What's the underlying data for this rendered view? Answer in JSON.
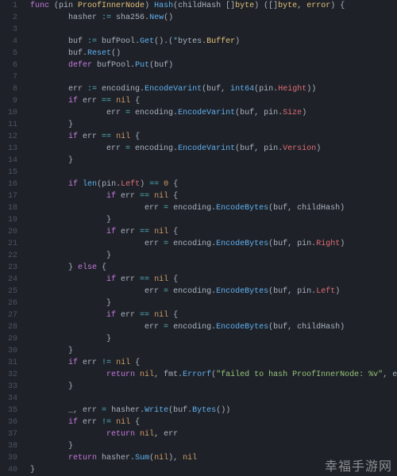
{
  "watermark": "幸福手游网",
  "gutter": {
    "start": 1,
    "end": 40
  },
  "code": {
    "l1": {
      "indent": 0,
      "seg": [
        [
          "kw",
          "func"
        ],
        [
          "pun",
          " ("
        ],
        [
          "var",
          "pin "
        ],
        [
          "typ",
          "ProofInnerNode"
        ],
        [
          "pun",
          ") "
        ],
        [
          "fn",
          "Hash"
        ],
        [
          "pun",
          "("
        ],
        [
          "var",
          "childHash "
        ],
        [
          "pun",
          "[]"
        ],
        [
          "typ",
          "byte"
        ],
        [
          "pun",
          ") ([]"
        ],
        [
          "typ",
          "byte"
        ],
        [
          "pun",
          ", "
        ],
        [
          "typ",
          "error"
        ],
        [
          "pun",
          ") {"
        ]
      ]
    },
    "l2": {
      "indent": 2,
      "seg": [
        [
          "var",
          "hasher "
        ],
        [
          "op",
          ":="
        ],
        [
          "var",
          " sha256"
        ],
        [
          "pun",
          "."
        ],
        [
          "fn",
          "New"
        ],
        [
          "pun",
          "()"
        ]
      ]
    },
    "l3": {
      "indent": 0,
      "seg": []
    },
    "l4": {
      "indent": 2,
      "seg": [
        [
          "var",
          "buf "
        ],
        [
          "op",
          ":="
        ],
        [
          "var",
          " bufPool"
        ],
        [
          "pun",
          "."
        ],
        [
          "fn",
          "Get"
        ],
        [
          "pun",
          "().("
        ],
        [
          "op",
          "*"
        ],
        [
          "var",
          "bytes"
        ],
        [
          "pun",
          "."
        ],
        [
          "typ",
          "Buffer"
        ],
        [
          "pun",
          ")"
        ]
      ]
    },
    "l5": {
      "indent": 2,
      "seg": [
        [
          "var",
          "buf"
        ],
        [
          "pun",
          "."
        ],
        [
          "fn",
          "Reset"
        ],
        [
          "pun",
          "()"
        ]
      ]
    },
    "l6": {
      "indent": 2,
      "seg": [
        [
          "kw",
          "defer"
        ],
        [
          "var",
          " bufPool"
        ],
        [
          "pun",
          "."
        ],
        [
          "fn",
          "Put"
        ],
        [
          "pun",
          "("
        ],
        [
          "var",
          "buf"
        ],
        [
          "pun",
          ")"
        ]
      ]
    },
    "l7": {
      "indent": 0,
      "seg": []
    },
    "l8": {
      "indent": 2,
      "seg": [
        [
          "var",
          "err "
        ],
        [
          "op",
          ":="
        ],
        [
          "var",
          " encoding"
        ],
        [
          "pun",
          "."
        ],
        [
          "fn",
          "EncodeVarint"
        ],
        [
          "pun",
          "("
        ],
        [
          "var",
          "buf"
        ],
        [
          "pun",
          ", "
        ],
        [
          "fn",
          "int64"
        ],
        [
          "pun",
          "("
        ],
        [
          "var",
          "pin"
        ],
        [
          "pun",
          "."
        ],
        [
          "ident",
          "Height"
        ],
        [
          "pun",
          "))"
        ]
      ]
    },
    "l9": {
      "indent": 2,
      "seg": [
        [
          "kw",
          "if"
        ],
        [
          "var",
          " err "
        ],
        [
          "op",
          "=="
        ],
        [
          "var",
          " "
        ],
        [
          "num",
          "nil"
        ],
        [
          "pun",
          " {"
        ]
      ]
    },
    "l10": {
      "indent": 4,
      "seg": [
        [
          "var",
          "err "
        ],
        [
          "op",
          "="
        ],
        [
          "var",
          " encoding"
        ],
        [
          "pun",
          "."
        ],
        [
          "fn",
          "EncodeVarint"
        ],
        [
          "pun",
          "("
        ],
        [
          "var",
          "buf"
        ],
        [
          "pun",
          ", "
        ],
        [
          "var",
          "pin"
        ],
        [
          "pun",
          "."
        ],
        [
          "ident",
          "Size"
        ],
        [
          "pun",
          ")"
        ]
      ]
    },
    "l11": {
      "indent": 2,
      "seg": [
        [
          "pun",
          "}"
        ]
      ]
    },
    "l12": {
      "indent": 2,
      "seg": [
        [
          "kw",
          "if"
        ],
        [
          "var",
          " err "
        ],
        [
          "op",
          "=="
        ],
        [
          "var",
          " "
        ],
        [
          "num",
          "nil"
        ],
        [
          "pun",
          " {"
        ]
      ]
    },
    "l13": {
      "indent": 4,
      "seg": [
        [
          "var",
          "err "
        ],
        [
          "op",
          "="
        ],
        [
          "var",
          " encoding"
        ],
        [
          "pun",
          "."
        ],
        [
          "fn",
          "EncodeVarint"
        ],
        [
          "pun",
          "("
        ],
        [
          "var",
          "buf"
        ],
        [
          "pun",
          ", "
        ],
        [
          "var",
          "pin"
        ],
        [
          "pun",
          "."
        ],
        [
          "ident",
          "Version"
        ],
        [
          "pun",
          ")"
        ]
      ]
    },
    "l14": {
      "indent": 2,
      "seg": [
        [
          "pun",
          "}"
        ]
      ]
    },
    "l15": {
      "indent": 0,
      "seg": []
    },
    "l16": {
      "indent": 2,
      "seg": [
        [
          "kw",
          "if"
        ],
        [
          "pun",
          " "
        ],
        [
          "fn",
          "len"
        ],
        [
          "pun",
          "("
        ],
        [
          "var",
          "pin"
        ],
        [
          "pun",
          "."
        ],
        [
          "ident",
          "Left"
        ],
        [
          "pun",
          ") "
        ],
        [
          "op",
          "=="
        ],
        [
          "pun",
          " "
        ],
        [
          "num",
          "0"
        ],
        [
          "pun",
          " {"
        ]
      ]
    },
    "l17": {
      "indent": 4,
      "seg": [
        [
          "kw",
          "if"
        ],
        [
          "var",
          " err "
        ],
        [
          "op",
          "=="
        ],
        [
          "var",
          " "
        ],
        [
          "num",
          "nil"
        ],
        [
          "pun",
          " {"
        ]
      ]
    },
    "l18": {
      "indent": 6,
      "seg": [
        [
          "var",
          "err "
        ],
        [
          "op",
          "="
        ],
        [
          "var",
          " encoding"
        ],
        [
          "pun",
          "."
        ],
        [
          "fn",
          "EncodeBytes"
        ],
        [
          "pun",
          "("
        ],
        [
          "var",
          "buf"
        ],
        [
          "pun",
          ", "
        ],
        [
          "var",
          "childHash"
        ],
        [
          "pun",
          ")"
        ]
      ]
    },
    "l19": {
      "indent": 4,
      "seg": [
        [
          "pun",
          "}"
        ]
      ]
    },
    "l20": {
      "indent": 4,
      "seg": [
        [
          "kw",
          "if"
        ],
        [
          "var",
          " err "
        ],
        [
          "op",
          "=="
        ],
        [
          "var",
          " "
        ],
        [
          "num",
          "nil"
        ],
        [
          "pun",
          " {"
        ]
      ]
    },
    "l21": {
      "indent": 6,
      "seg": [
        [
          "var",
          "err "
        ],
        [
          "op",
          "="
        ],
        [
          "var",
          " encoding"
        ],
        [
          "pun",
          "."
        ],
        [
          "fn",
          "EncodeBytes"
        ],
        [
          "pun",
          "("
        ],
        [
          "var",
          "buf"
        ],
        [
          "pun",
          ", "
        ],
        [
          "var",
          "pin"
        ],
        [
          "pun",
          "."
        ],
        [
          "ident",
          "Right"
        ],
        [
          "pun",
          ")"
        ]
      ]
    },
    "l22": {
      "indent": 4,
      "seg": [
        [
          "pun",
          "}"
        ]
      ]
    },
    "l23": {
      "indent": 2,
      "seg": [
        [
          "pun",
          "} "
        ],
        [
          "kw",
          "else"
        ],
        [
          "pun",
          " {"
        ]
      ]
    },
    "l24": {
      "indent": 4,
      "seg": [
        [
          "kw",
          "if"
        ],
        [
          "var",
          " err "
        ],
        [
          "op",
          "=="
        ],
        [
          "var",
          " "
        ],
        [
          "num",
          "nil"
        ],
        [
          "pun",
          " {"
        ]
      ]
    },
    "l25": {
      "indent": 6,
      "seg": [
        [
          "var",
          "err "
        ],
        [
          "op",
          "="
        ],
        [
          "var",
          " encoding"
        ],
        [
          "pun",
          "."
        ],
        [
          "fn",
          "EncodeBytes"
        ],
        [
          "pun",
          "("
        ],
        [
          "var",
          "buf"
        ],
        [
          "pun",
          ", "
        ],
        [
          "var",
          "pin"
        ],
        [
          "pun",
          "."
        ],
        [
          "ident",
          "Left"
        ],
        [
          "pun",
          ")"
        ]
      ]
    },
    "l26": {
      "indent": 4,
      "seg": [
        [
          "pun",
          "}"
        ]
      ]
    },
    "l27": {
      "indent": 4,
      "seg": [
        [
          "kw",
          "if"
        ],
        [
          "var",
          " err "
        ],
        [
          "op",
          "=="
        ],
        [
          "var",
          " "
        ],
        [
          "num",
          "nil"
        ],
        [
          "pun",
          " {"
        ]
      ]
    },
    "l28": {
      "indent": 6,
      "seg": [
        [
          "var",
          "err "
        ],
        [
          "op",
          "="
        ],
        [
          "var",
          " encoding"
        ],
        [
          "pun",
          "."
        ],
        [
          "fn",
          "EncodeBytes"
        ],
        [
          "pun",
          "("
        ],
        [
          "var",
          "buf"
        ],
        [
          "pun",
          ", "
        ],
        [
          "var",
          "childHash"
        ],
        [
          "pun",
          ")"
        ]
      ]
    },
    "l29": {
      "indent": 4,
      "seg": [
        [
          "pun",
          "}"
        ]
      ]
    },
    "l30": {
      "indent": 2,
      "seg": [
        [
          "pun",
          "}"
        ]
      ]
    },
    "l31": {
      "indent": 2,
      "seg": [
        [
          "kw",
          "if"
        ],
        [
          "var",
          " err "
        ],
        [
          "op",
          "!="
        ],
        [
          "var",
          " "
        ],
        [
          "num",
          "nil"
        ],
        [
          "pun",
          " {"
        ]
      ]
    },
    "l32": {
      "indent": 4,
      "seg": [
        [
          "kw",
          "return"
        ],
        [
          "var",
          " "
        ],
        [
          "num",
          "nil"
        ],
        [
          "pun",
          ", "
        ],
        [
          "var",
          "fmt"
        ],
        [
          "pun",
          "."
        ],
        [
          "fn",
          "Errorf"
        ],
        [
          "pun",
          "("
        ],
        [
          "str",
          "\"failed to hash ProofInnerNode: %v\""
        ],
        [
          "pun",
          ", "
        ],
        [
          "var",
          "err"
        ],
        [
          "pun",
          ")"
        ]
      ]
    },
    "l33": {
      "indent": 2,
      "seg": [
        [
          "pun",
          "}"
        ]
      ]
    },
    "l34": {
      "indent": 0,
      "seg": []
    },
    "l35": {
      "indent": 2,
      "seg": [
        [
          "var",
          "_"
        ],
        [
          "pun",
          ", "
        ],
        [
          "var",
          "err "
        ],
        [
          "op",
          "="
        ],
        [
          "var",
          " hasher"
        ],
        [
          "pun",
          "."
        ],
        [
          "fn",
          "Write"
        ],
        [
          "pun",
          "("
        ],
        [
          "var",
          "buf"
        ],
        [
          "pun",
          "."
        ],
        [
          "fn",
          "Bytes"
        ],
        [
          "pun",
          "())"
        ]
      ]
    },
    "l36": {
      "indent": 2,
      "seg": [
        [
          "kw",
          "if"
        ],
        [
          "var",
          " err "
        ],
        [
          "op",
          "!="
        ],
        [
          "var",
          " "
        ],
        [
          "num",
          "nil"
        ],
        [
          "pun",
          " {"
        ]
      ]
    },
    "l37": {
      "indent": 4,
      "seg": [
        [
          "kw",
          "return"
        ],
        [
          "var",
          " "
        ],
        [
          "num",
          "nil"
        ],
        [
          "pun",
          ", "
        ],
        [
          "var",
          "err"
        ]
      ]
    },
    "l38": {
      "indent": 2,
      "seg": [
        [
          "pun",
          "}"
        ]
      ]
    },
    "l39": {
      "indent": 2,
      "seg": [
        [
          "kw",
          "return"
        ],
        [
          "var",
          " hasher"
        ],
        [
          "pun",
          "."
        ],
        [
          "fn",
          "Sum"
        ],
        [
          "pun",
          "("
        ],
        [
          "num",
          "nil"
        ],
        [
          "pun",
          "), "
        ],
        [
          "num",
          "nil"
        ]
      ]
    },
    "l40": {
      "indent": 0,
      "seg": [
        [
          "pun",
          "}"
        ]
      ]
    }
  }
}
